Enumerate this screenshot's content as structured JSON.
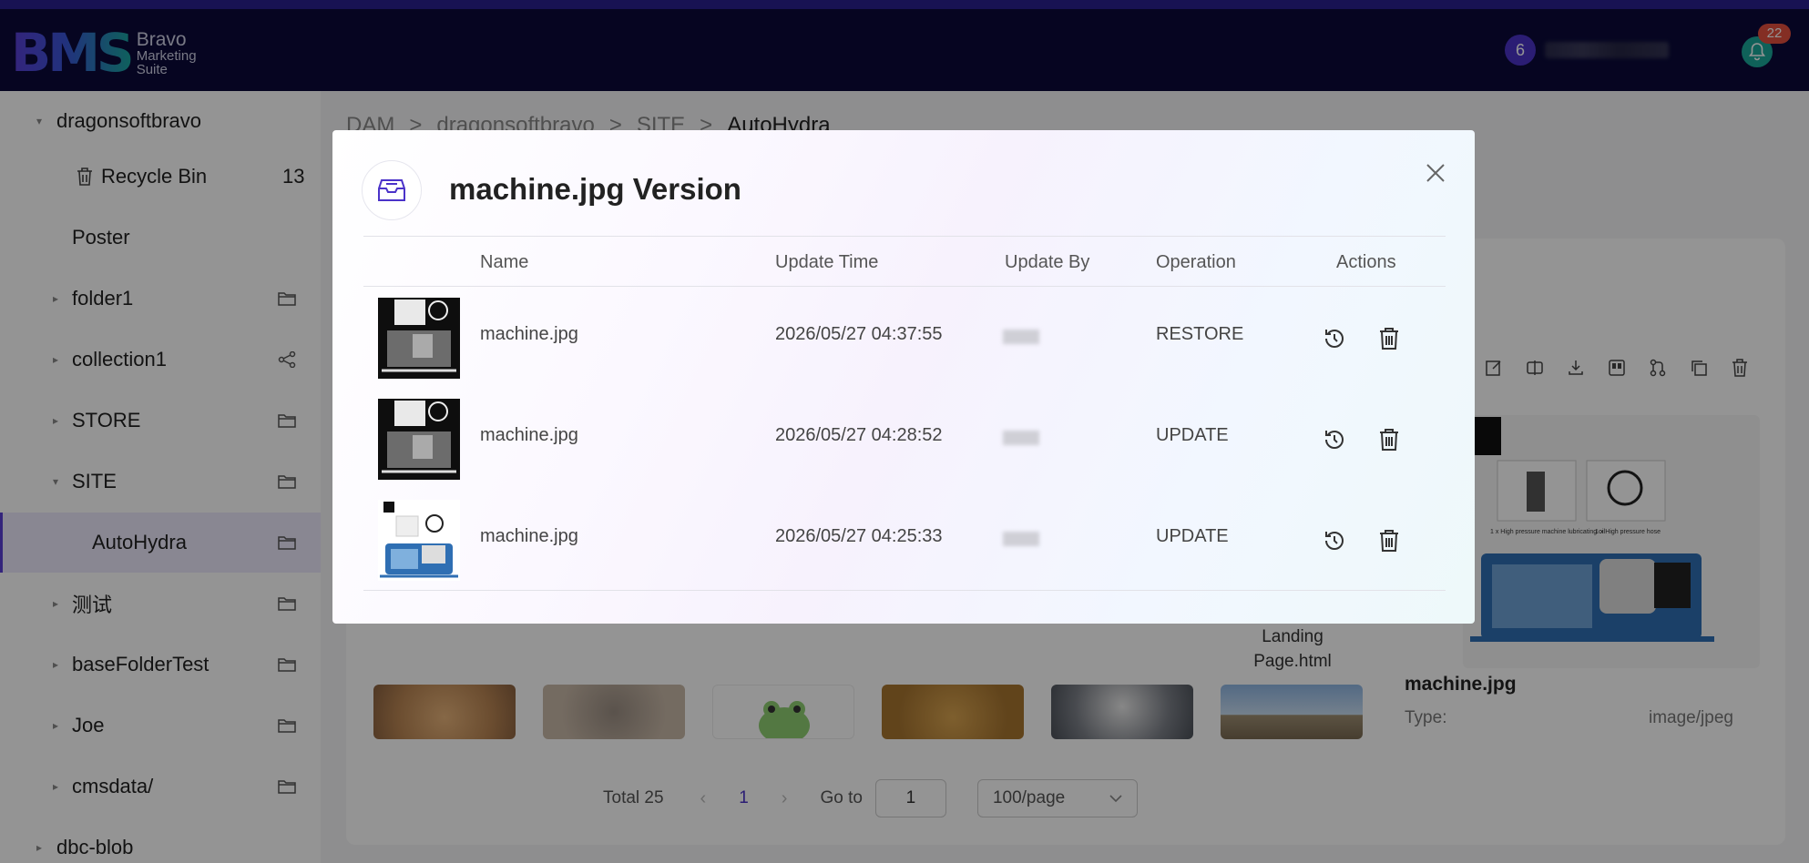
{
  "header": {
    "logo_mark": "BMS",
    "logo_line1": "Bravo",
    "logo_line2": "Marketing",
    "logo_line3": "Suite",
    "user_avatar": "6",
    "notifications_badge": "22"
  },
  "sidebar": {
    "items": [
      {
        "label": "dragonsoftbravo",
        "caret": "▾"
      },
      {
        "label": "Recycle Bin",
        "count": "13"
      },
      {
        "label": "Poster"
      },
      {
        "label": "folder1",
        "caret": "▸",
        "icon": "folder-icon"
      },
      {
        "label": "collection1",
        "caret": "▸",
        "icon": "share-icon"
      },
      {
        "label": "STORE",
        "caret": "▸",
        "icon": "folder-icon"
      },
      {
        "label": "SITE",
        "caret": "▾",
        "icon": "folder-icon"
      },
      {
        "label": "AutoHydra",
        "icon": "folder-icon",
        "active": true
      },
      {
        "label": "测试",
        "caret": "▸",
        "icon": "folder-icon"
      },
      {
        "label": "baseFolderTest",
        "caret": "▸",
        "icon": "folder-icon"
      },
      {
        "label": "Joe",
        "caret": "▸",
        "icon": "folder-icon"
      },
      {
        "label": "cmsdata/",
        "caret": "▸",
        "icon": "folder-icon"
      },
      {
        "label": "dbc-blob",
        "caret": "▸"
      }
    ]
  },
  "breadcrumb": [
    "DAM",
    ">",
    "dragonsoftbravo",
    ">",
    "SITE",
    ">",
    "AutoHydra"
  ],
  "main": {
    "landing_line1": "Landing",
    "landing_line2": "Page.html"
  },
  "detail": {
    "name": "machine.jpg",
    "type_label": "Type:",
    "type_value": "image/jpeg",
    "caption_left": "1 x High pressure machine lubricating oil",
    "caption_right": "1 x High pressure hose"
  },
  "pagination": {
    "total": "Total 25",
    "prev": "‹",
    "current": "1",
    "next": "›",
    "goto_label": "Go to",
    "goto_value": "1",
    "page_size": "100/page"
  },
  "modal": {
    "title": "machine.jpg Version",
    "columns": [
      "Name",
      "Update Time",
      "Update By",
      "Operation",
      "Actions"
    ],
    "rows": [
      {
        "name": "machine.jpg",
        "time": "2026/05/27 04:37:55",
        "operation": "RESTORE"
      },
      {
        "name": "machine.jpg",
        "time": "2026/05/27 04:28:52",
        "operation": "UPDATE"
      },
      {
        "name": "machine.jpg",
        "time": "2026/05/27 04:25:33",
        "operation": "UPDATE"
      }
    ]
  },
  "colors": {
    "brand_purple": "#4b33c9",
    "brand_teal": "#1aa79a",
    "header_bg": "#0b0a3a",
    "badge_red": "#e3503e"
  }
}
